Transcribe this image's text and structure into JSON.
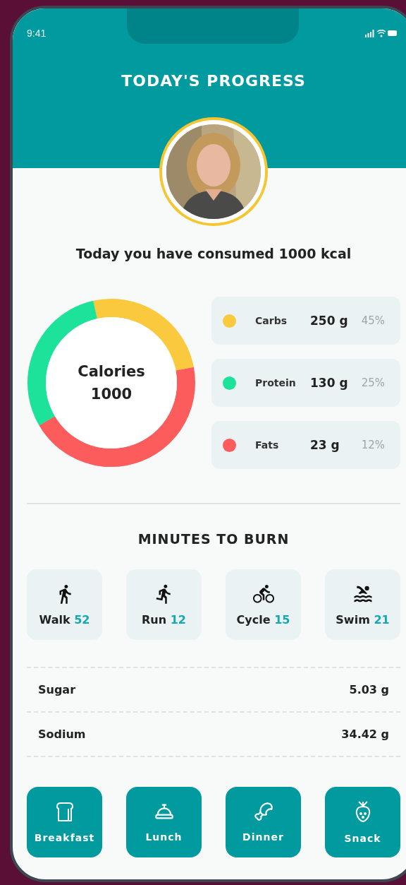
{
  "status_bar": {
    "time": "9:41"
  },
  "header": {
    "title": "TODAY'S PROGRESS"
  },
  "summary": "Today you have consumed 1000 kcal",
  "donut": {
    "label": "Calories",
    "value": "1000"
  },
  "macros": [
    {
      "name": "Carbs",
      "amount": "250 g",
      "percent": "45%",
      "color": "#fbc93d"
    },
    {
      "name": "Protein",
      "amount": "130 g",
      "percent": "25%",
      "color": "#1de39a"
    },
    {
      "name": "Fats",
      "amount": "23 g",
      "percent": "12%",
      "color": "#fd5c5c"
    }
  ],
  "burn": {
    "title": "MINUTES TO BURN",
    "activities": [
      {
        "kind": "walk",
        "name": "Walk",
        "minutes": "52"
      },
      {
        "kind": "run",
        "name": "Run",
        "minutes": "12"
      },
      {
        "kind": "cycle",
        "name": "Cycle",
        "minutes": "15"
      },
      {
        "kind": "swim",
        "name": "Swim",
        "minutes": "21"
      }
    ]
  },
  "nutrients": [
    {
      "name": "Sugar",
      "value": "5.03 g"
    },
    {
      "name": "Sodium",
      "value": "34.42 g"
    }
  ],
  "meals": [
    {
      "kind": "breakfast",
      "label": "Breakfast"
    },
    {
      "kind": "lunch",
      "label": "Lunch"
    },
    {
      "kind": "dinner",
      "label": "Dinner"
    },
    {
      "kind": "snack",
      "label": "Snack"
    }
  ]
}
